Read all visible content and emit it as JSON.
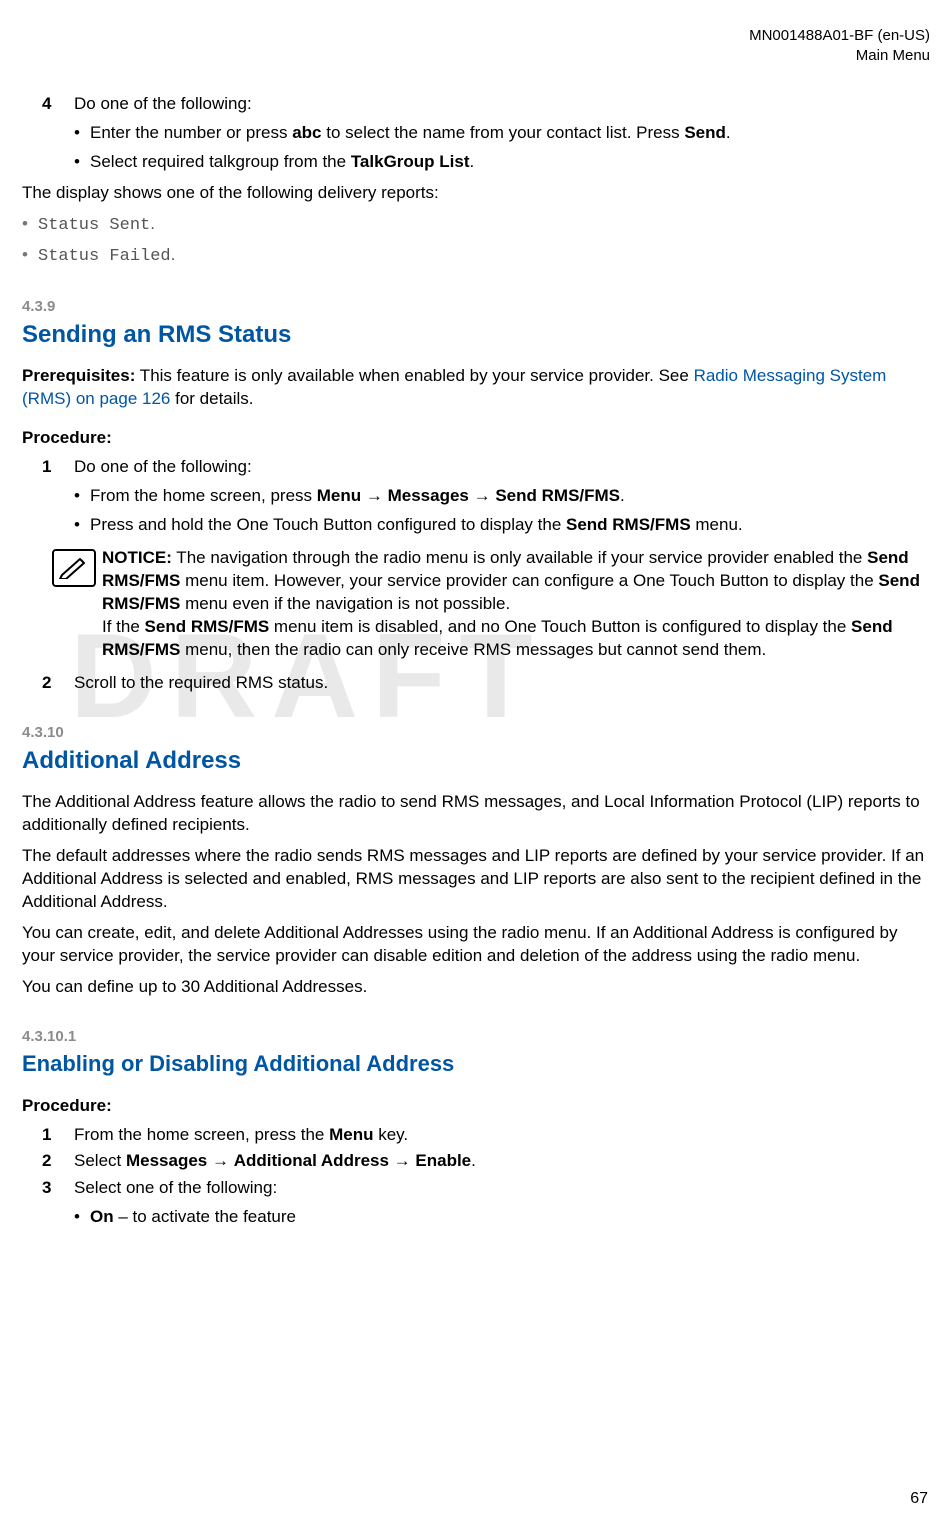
{
  "header": {
    "doc_id": "MN001488A01-BF (en-US)",
    "section": "Main Menu"
  },
  "watermark": "DRAFT",
  "block1": {
    "step4_num": "4",
    "step4_text": "Do one of the following:",
    "step4_b1_pre": "Enter the number or press ",
    "step4_b1_bold1": "abc",
    "step4_b1_mid": " to select the name from your contact list. Press ",
    "step4_b1_bold2": "Send",
    "step4_b1_post": ".",
    "step4_b2_pre": "Select required talkgroup from the ",
    "step4_b2_bold": "TalkGroup List",
    "step4_b2_post": ".",
    "result_intro": "The display shows one of the following delivery reports:",
    "result_a": "Status Sent",
    "result_a_post": ".",
    "result_b": "Status Failed",
    "result_b_post": "."
  },
  "sec439": {
    "num": "4.3.9",
    "title": "Sending an RMS Status",
    "prereq_label": "Prerequisites:",
    "prereq_text_pre": " This feature is only available when enabled by your service provider. See ",
    "prereq_link": "Radio Messaging System (RMS) on page 126",
    "prereq_text_post": " for details.",
    "proc_label": "Procedure:",
    "s1_num": "1",
    "s1_text": "Do one of the following:",
    "s1_b1_pre": "From the home screen, press ",
    "s1_b1_bold1": "Menu",
    "s1_b1_arrow1": " → ",
    "s1_b1_bold2": "Messages",
    "s1_b1_arrow2": " → ",
    "s1_b1_bold3": "Send RMS/FMS",
    "s1_b1_post": ".",
    "s1_b2_pre": "Press and hold the One Touch Button configured to display the ",
    "s1_b2_bold": "Send RMS/FMS",
    "s1_b2_post": " menu.",
    "notice_label": "NOTICE:",
    "notice_p1_pre": " The navigation through the radio menu is only available if your service provider enabled the ",
    "notice_p1_bold1": "Send RMS/FMS",
    "notice_p1_mid": " menu item. However, your service provider can configure a One Touch Button to display the ",
    "notice_p1_bold2": "Send RMS/FMS",
    "notice_p1_post": " menu even if the navigation is not possible.",
    "notice_p2_pre": "If the ",
    "notice_p2_bold1": "Send RMS/FMS",
    "notice_p2_mid": " menu item is disabled, and no One Touch Button is configured to display the ",
    "notice_p2_bold2": "Send RMS/FMS",
    "notice_p2_post": " menu, then the radio can only receive RMS messages but cannot send them.",
    "s2_num": "2",
    "s2_text": "Scroll to the required RMS status."
  },
  "sec4310": {
    "num": "4.3.10",
    "title": "Additional Address",
    "p1": "The Additional Address feature allows the radio to send RMS messages, and Local Information Protocol (LIP) reports to additionally defined recipients.",
    "p2": "The default addresses where the radio sends RMS messages and LIP reports are defined by your service provider. If an Additional Address is selected and enabled, RMS messages and LIP reports are also sent to the recipient defined in the Additional Address.",
    "p3": "You can create, edit, and delete Additional Addresses using the radio menu. If an Additional Address is configured by your service provider, the service provider can disable edition and deletion of the address using the radio menu.",
    "p4": "You can define up to 30 Additional Addresses."
  },
  "sec43101": {
    "num": "4.3.10.1",
    "title": "Enabling or Disabling Additional Address",
    "proc_label": "Procedure:",
    "s1_num": "1",
    "s1_pre": "From the home screen, press the ",
    "s1_bold": "Menu",
    "s1_post": " key.",
    "s2_num": "2",
    "s2_pre": "Select ",
    "s2_bold1": "Messages",
    "s2_arrow1": " → ",
    "s2_bold2": "Additional Address",
    "s2_arrow2": " → ",
    "s2_bold3": "Enable",
    "s2_post": ".",
    "s3_num": "3",
    "s3_text": "Select one of the following:",
    "s3_b1_bold": "On",
    "s3_b1_post": " – to activate the feature"
  },
  "page_number": "67"
}
